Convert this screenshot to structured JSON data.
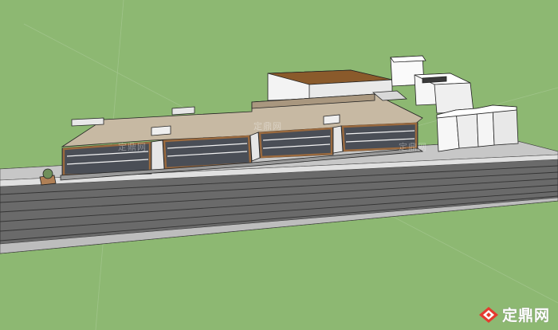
{
  "watermark": {
    "brand": "定鼎网",
    "logo_icon": "diamond-logo-icon",
    "color": "#ffffff"
  },
  "colors": {
    "grass": "#8db872",
    "road": "#5b5b5b",
    "sidewalk": "#c9c9c9",
    "roof": "#c7b9a3",
    "facade_trim": "#9b6a3e",
    "window": "#4a4e56",
    "white_block": "#f2f2f2",
    "brown_roof": "#8a5a2b"
  }
}
